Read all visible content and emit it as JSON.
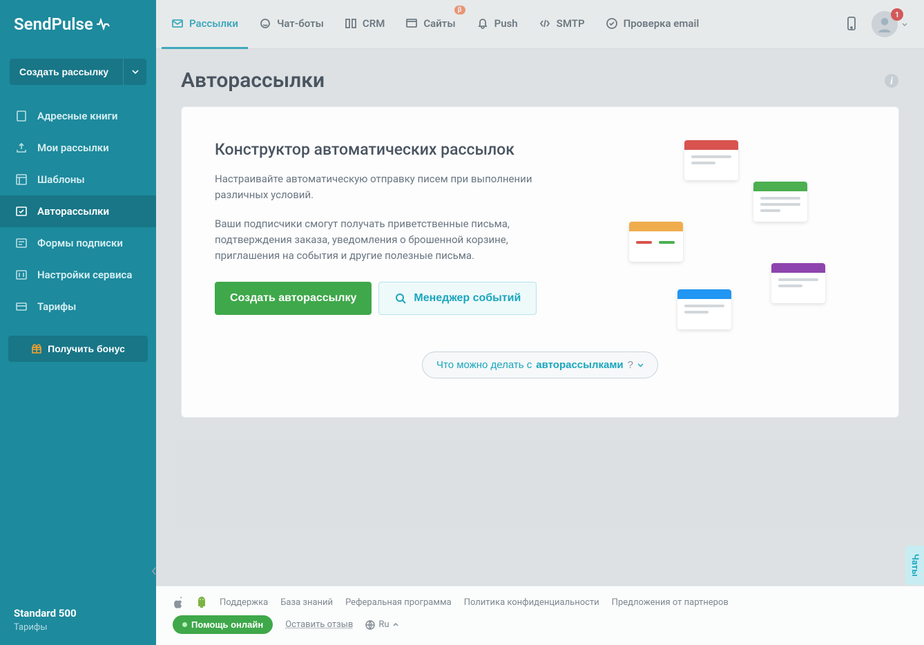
{
  "brand": "SendPulse",
  "sidebar": {
    "create_label": "Создать рассылку",
    "items": [
      {
        "label": "Адресные книги"
      },
      {
        "label": "Мои рассылки"
      },
      {
        "label": "Шаблоны"
      },
      {
        "label": "Авторассылки"
      },
      {
        "label": "Формы подписки"
      },
      {
        "label": "Настройки сервиса"
      },
      {
        "label": "Тарифы"
      }
    ],
    "bonus_label": "Получить бонус",
    "plan_name": "Standard 500",
    "plan_sub": "Тарифы"
  },
  "topnav": {
    "items": [
      {
        "label": "Рассылки",
        "active": true
      },
      {
        "label": "Чат-боты"
      },
      {
        "label": "CRM"
      },
      {
        "label": "Сайты",
        "badge": "β"
      },
      {
        "label": "Push"
      },
      {
        "label": "SMTP"
      },
      {
        "label": "Проверка email"
      }
    ],
    "notifications_count": "1"
  },
  "page": {
    "title": "Авторассылки",
    "card_title": "Конструктор автоматических рассылок",
    "card_p1": "Настраивайте автоматическую отправку писем при выполнении различных условий.",
    "card_p2": "Ваши подписчики смогут получать приветственные письма, подтверждения заказа, уведомления о брошенной корзине, приглашения на события и другие полезные письма.",
    "btn_primary": "Создать авторассылку",
    "btn_secondary": "Менеджер событий",
    "hint_prefix": "Что можно делать с ",
    "hint_strong": "авторассылками",
    "hint_q": " ?"
  },
  "footer": {
    "links": [
      "Поддержка",
      "База знаний",
      "Реферальная программа",
      "Политика конфиденциальности",
      "Предложения от партнеров"
    ],
    "help_online": "Помощь онлайн",
    "leave_review": "Оставить отзыв",
    "lang": "Ru"
  },
  "chat_tab": "Чаты"
}
